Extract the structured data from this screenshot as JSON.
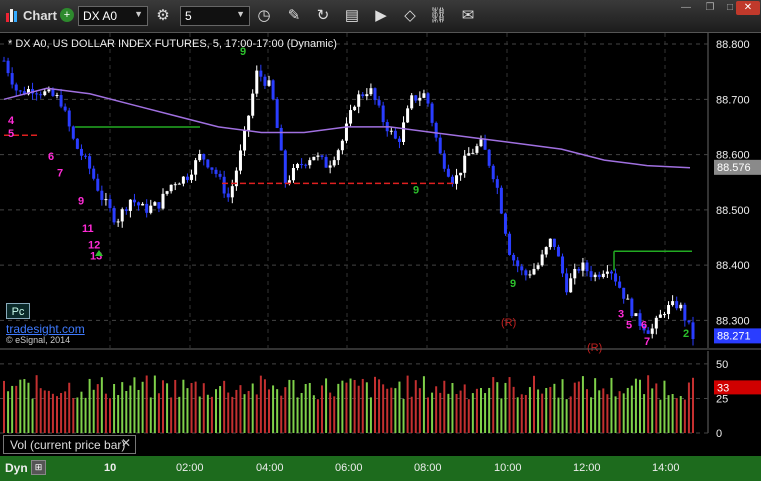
{
  "toolbar": {
    "app_title": "Chart",
    "favorite_icon": "plus-icon",
    "symbol_value": "DX A0",
    "interval_value": "5",
    "tools": [
      "clock-icon",
      "pencil-icon",
      "refresh-icon",
      "study-icon",
      "play-icon",
      "link-icon",
      "message-icon"
    ]
  },
  "chart": {
    "title": "* DX A0, US DOLLAR INDEX FUTURES, 5, 17:00-17:00 (Dynamic)",
    "pc_badge": "Pc",
    "brand": "tradesight.com",
    "copyright": "© eSignal, 2014",
    "price_axis": [
      "88.800",
      "88.700",
      "88.600",
      "88.500",
      "88.400",
      "88.300"
    ],
    "last_price": "88.271",
    "ma_price": "88.576",
    "volume_axis": [
      "50",
      "25",
      "0"
    ],
    "volume_value": "33",
    "volume_tab": "Vol (current price bar)",
    "r_labels": [
      "(R)",
      "(R)"
    ]
  },
  "time_axis": {
    "dyn_label": "Dyn",
    "labels": [
      "10",
      "02:00",
      "04:00",
      "06:00",
      "08:00",
      "10:00",
      "12:00",
      "14:00"
    ]
  },
  "colors": {
    "up_bar": "#ffffff",
    "down_bar": "#2a3dff",
    "ma_line": "#a070e0",
    "green_support": "#22aa22",
    "red_resistance": "#e02020",
    "magenta_count": "#ff2bd6",
    "green_count": "#2cc02c",
    "last_price_bg": "#2a3dff",
    "volume_bg": "#d00000"
  },
  "chart_data": {
    "type": "candlestick",
    "y_axis_range": [
      88.25,
      88.82
    ],
    "close_path_values": [
      88.77,
      88.71,
      88.72,
      88.71,
      88.7,
      88.62,
      88.58,
      88.52,
      88.48,
      88.52,
      88.5,
      88.51,
      88.55,
      88.56,
      88.6,
      88.57,
      88.52,
      88.62,
      88.75,
      88.72,
      88.55,
      88.58,
      88.6,
      88.58,
      88.62,
      88.7,
      88.72,
      88.66,
      88.62,
      88.7,
      88.71,
      88.6,
      88.55,
      88.6,
      88.62,
      88.55,
      88.42,
      88.38,
      88.4,
      88.45,
      88.36,
      88.4,
      88.38,
      88.4,
      88.35,
      88.3,
      88.28,
      88.32,
      88.33,
      88.27
    ],
    "ma_values": [
      88.7,
      88.72,
      88.71,
      88.69,
      88.67,
      88.65,
      88.64,
      88.64,
      88.65,
      88.65,
      88.64,
      88.63,
      88.62,
      88.61,
      88.59,
      88.58,
      88.576
    ],
    "volume_series": "per-bar volume, approx 20-45 range",
    "volume_last": 33
  }
}
